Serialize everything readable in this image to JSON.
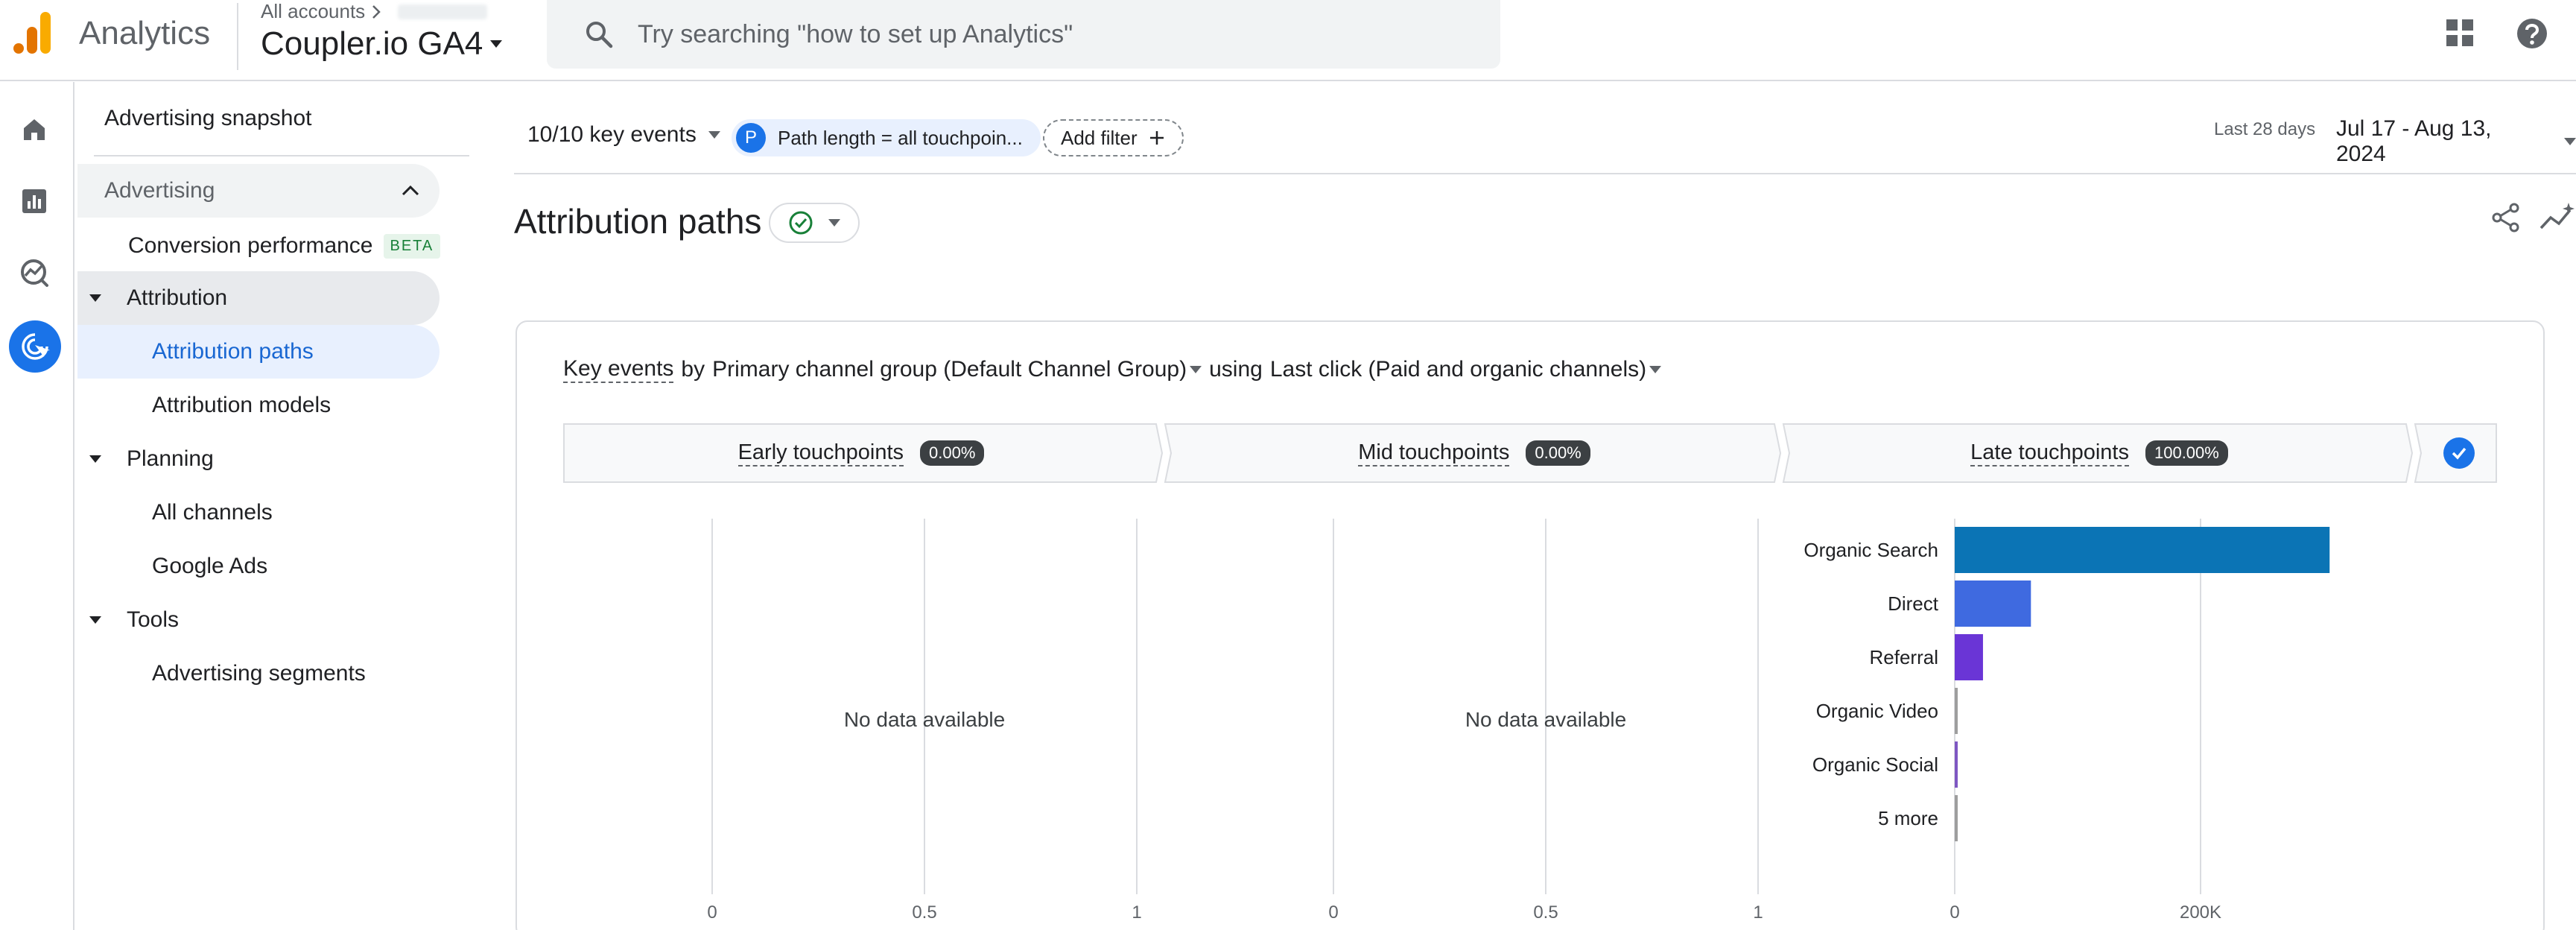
{
  "header": {
    "app_name": "Analytics",
    "breadcrumb": "All accounts",
    "property": "Coupler.io GA4",
    "search_placeholder": "Try searching \"how to set up Analytics\""
  },
  "rail": {
    "icons": [
      "home-icon",
      "reports-icon",
      "explore-icon",
      "advertising-icon"
    ]
  },
  "nav": {
    "snapshot": "Advertising snapshot",
    "section": "Advertising",
    "conversion": "Conversion performance",
    "beta": "BETA",
    "attribution": "Attribution",
    "attribution_paths": "Attribution paths",
    "attribution_models": "Attribution models",
    "planning": "Planning",
    "all_channels": "All channels",
    "google_ads": "Google Ads",
    "tools": "Tools",
    "segments": "Advertising segments"
  },
  "filters": {
    "key_events": "10/10 key events",
    "chip_letter": "P",
    "chip_text": "Path length = all touchpoin...",
    "add_filter": "Add filter",
    "date_label": "Last 28 days",
    "date_range": "Jul 17 - Aug 13, 2024"
  },
  "page": {
    "title": "Attribution paths"
  },
  "card": {
    "desc_metric": "Key events",
    "desc_by": "by",
    "desc_dimension": "Primary channel group (Default Channel Group)",
    "desc_using": "using",
    "desc_model": "Last click (Paid and organic channels)",
    "early": "Early touchpoints",
    "early_pct": "0.00%",
    "mid": "Mid touchpoints",
    "mid_pct": "0.00%",
    "late": "Late touchpoints",
    "late_pct": "100.00%",
    "no_data": "No data available"
  },
  "chart_data": [
    {
      "type": "bar",
      "title": "",
      "values": [],
      "xlim": [
        0,
        1
      ],
      "x_ticks": [
        "0",
        "0.5",
        "1"
      ],
      "annotation": "No data available"
    },
    {
      "type": "bar",
      "title": "",
      "values": [],
      "xlim": [
        0,
        1
      ],
      "x_ticks": [
        "0",
        "0.5",
        "1"
      ],
      "annotation": "No data available"
    },
    {
      "type": "bar",
      "orientation": "horizontal",
      "categories": [
        "Organic Search",
        "Direct",
        "Referral",
        "Organic Video",
        "Organic Social",
        "5 more"
      ],
      "values": [
        305000,
        62000,
        23000,
        1500,
        1500,
        1500
      ],
      "colors": [
        "#0b74b5",
        "#3f6ae0",
        "#6a35d6",
        "#9e9e9e",
        "#7e57c2",
        "#9e9e9e"
      ],
      "xlim": [
        0,
        400000
      ],
      "x_ticks": [
        "0",
        "200K"
      ],
      "grid": true
    }
  ]
}
